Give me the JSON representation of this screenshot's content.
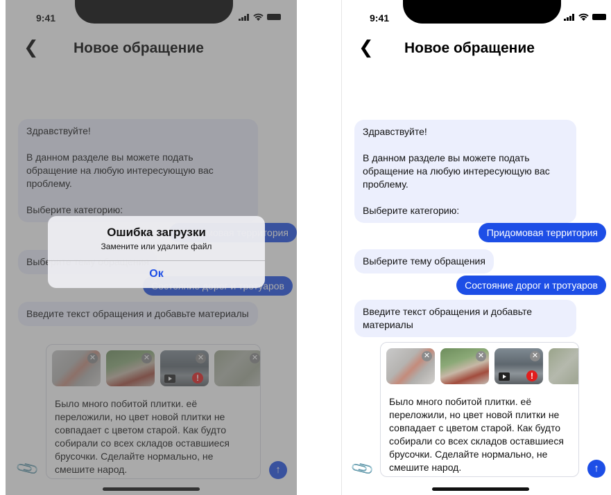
{
  "status_bar": {
    "time": "9:41"
  },
  "header": {
    "title": "Новое обращение"
  },
  "chat": {
    "greeting": "Здравствуйте!",
    "intro": "В данном разделе вы можете подать обращение на любую интересующую вас проблему.",
    "choose_category": "Выберите категорию:",
    "category_answer": "Придомовая территория",
    "choose_topic": "Выберите тему обращения",
    "topic_answer": "Состояние дорог и тротуаров",
    "enter_text_prompt": "Введите текст обращения и добавьте материалы"
  },
  "composer": {
    "text": "Было много побитой плитки. её переложили, но цвет новой плитки не совпадает с цветом старой. Как будто собирали со всех складов оставшиеся брусочки. Сделайте нормально, не смешите народ.",
    "attachments": [
      {
        "kind": "photo",
        "remove_icon": "close-icon"
      },
      {
        "kind": "photo",
        "remove_icon": "close-icon"
      },
      {
        "kind": "video",
        "remove_icon": "close-icon",
        "error": true,
        "error_icon": "error-icon",
        "error_glyph": "!"
      },
      {
        "kind": "photo",
        "remove_icon": "close-icon"
      }
    ],
    "remove_glyph": "✕",
    "attach_icon": "paperclip-icon",
    "send_icon": "arrow-up-icon",
    "send_glyph": "↑"
  },
  "alert": {
    "title": "Ошибка загрузки",
    "message": "Замените или удалите файл",
    "ok_label": "Ок"
  },
  "colors": {
    "accent": "#1d4ee6",
    "bot_bubble": "#eceffd",
    "error": "#e21d1d"
  }
}
